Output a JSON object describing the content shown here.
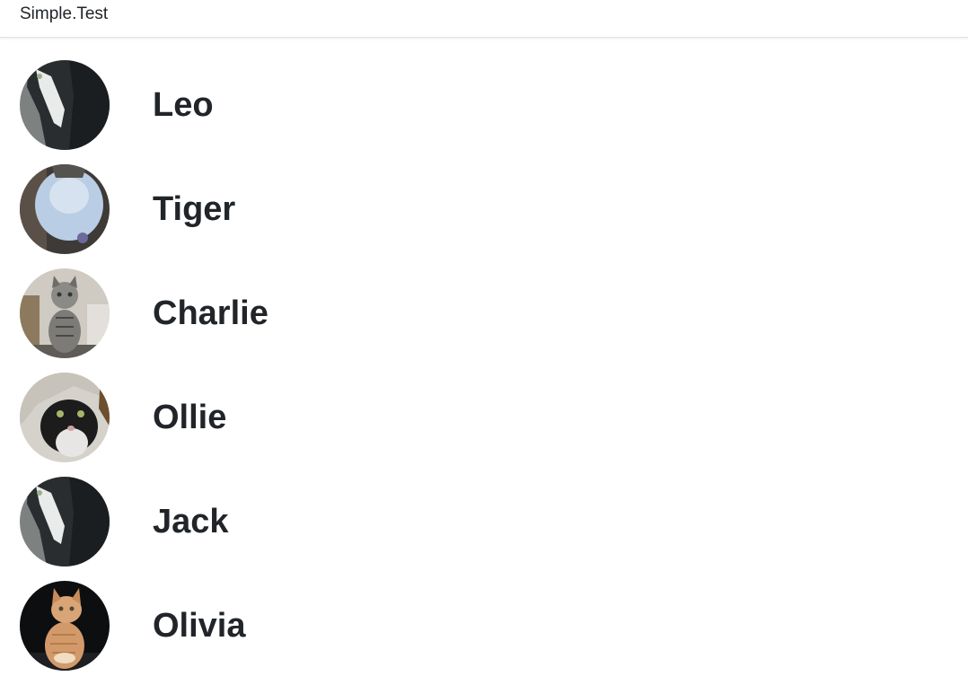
{
  "navbar": {
    "brand": "Simple.Test"
  },
  "cats": [
    {
      "name": "Leo",
      "photo": "tuxedo-cat-photo"
    },
    {
      "name": "Tiger",
      "photo": "white-chest-cat-photo"
    },
    {
      "name": "Charlie",
      "photo": "tabby-kitten-photo"
    },
    {
      "name": "Ollie",
      "photo": "tuxedo-cat-under-blanket-photo"
    },
    {
      "name": "Jack",
      "photo": "tuxedo-cat-photo"
    },
    {
      "name": "Olivia",
      "photo": "orange-tabby-cat-photo"
    }
  ]
}
